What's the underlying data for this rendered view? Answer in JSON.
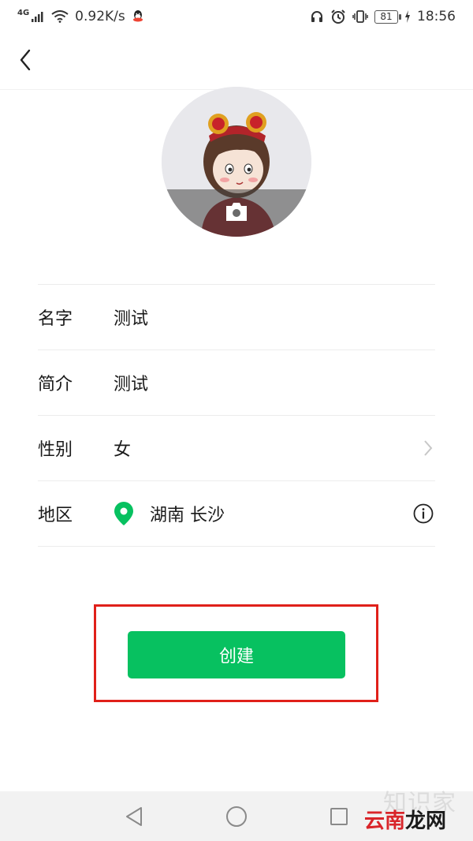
{
  "status_bar": {
    "network_type": "4G",
    "speed": "0.92K/s",
    "battery": "81",
    "time": "18:56",
    "icons": [
      "signal-icon",
      "wifi-icon",
      "qq-icon",
      "headphone-icon",
      "alarm-icon",
      "vibrate-icon",
      "battery-icon",
      "charging-icon"
    ]
  },
  "header": {
    "back_icon": "chevron-left-icon"
  },
  "avatar": {
    "overlay_icon": "camera-icon"
  },
  "form": {
    "rows": [
      {
        "label": "名字",
        "value": "测试"
      },
      {
        "label": "简介",
        "value": "测试"
      },
      {
        "label": "性别",
        "value": "女"
      },
      {
        "label": "地区",
        "value": "湖南 长沙"
      }
    ]
  },
  "actions": {
    "create_label": "创建"
  },
  "colors": {
    "accent": "#07c160",
    "highlight": "#e0201a",
    "location_pin": "#07c160"
  },
  "watermark": {
    "top": "知识家",
    "main_a": "云南",
    "main_b": "龙网"
  }
}
